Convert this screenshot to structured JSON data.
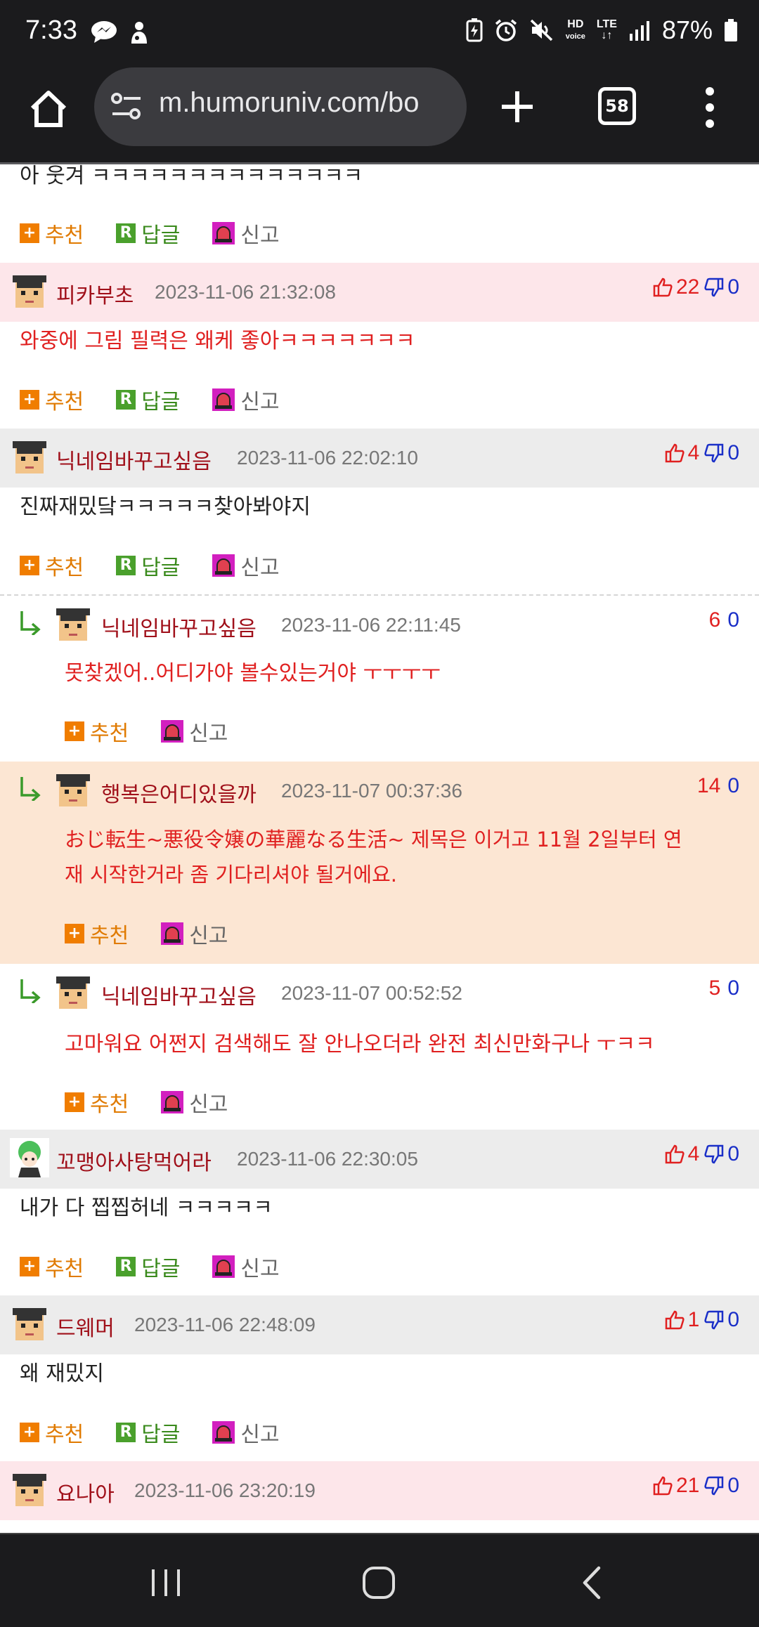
{
  "status": {
    "time": "7:33",
    "battery": "87%",
    "hd_label": "HD",
    "voice_label": "voice",
    "lte_label": "LTE"
  },
  "browser": {
    "url": "m.humoruniv.com/bo",
    "tab_count": "58"
  },
  "actions": {
    "recommend": "추천",
    "reply": "답글",
    "report": "신고"
  },
  "comments": [
    {
      "text": "아 웃겨 ㅋㅋㅋㅋㅋㅋㅋㅋㅋㅋㅋㅋㅋㅋ"
    },
    {
      "nick": "피카부초",
      "date": "2023-11-06 21:32:08",
      "up": "22",
      "down": "0",
      "text": "와중에 그림 필력은 왜케 좋아ㅋㅋㅋㅋㅋㅋㅋ"
    },
    {
      "nick": "닉네임바꾸고싶음",
      "date": "2023-11-06 22:02:10",
      "up": "4",
      "down": "0",
      "text": "진짜재밌닼ㅋㅋㅋㅋㅋ찾아봐야지"
    },
    {
      "nick": "닉네임바꾸고싶음",
      "date": "2023-11-06 22:11:45",
      "up": "6",
      "down": "0",
      "text": "못찾겠어..어디가야 볼수있는거야 ㅜㅜㅜㅜ"
    },
    {
      "nick": "행복은어디있을까",
      "date": "2023-11-07 00:37:36",
      "up": "14",
      "down": "0",
      "text1": "おじ転生~悪役令嬢の華麗なる生活~ 제목은 이거고 11월 2일부터 연",
      "text2": "재 시작한거라 좀 기다리셔야 될거에요."
    },
    {
      "nick": "닉네임바꾸고싶음",
      "date": "2023-11-07 00:52:52",
      "up": "5",
      "down": "0",
      "text": "고마워요 어쩐지 검색해도 잘 안나오더라 완전 최신만화구나 ㅜㅋㅋ"
    },
    {
      "nick": "꼬맹아사탕먹어라",
      "date": "2023-11-06 22:30:05",
      "up": "4",
      "down": "0",
      "text": "내가 다 찝찝허네 ㅋㅋㅋㅋㅋ"
    },
    {
      "nick": "드웨머",
      "date": "2023-11-06 22:48:09",
      "up": "1",
      "down": "0",
      "text": "왜 재밌지"
    },
    {
      "nick": "요나아",
      "date": "2023-11-06 23:20:19",
      "up": "21",
      "down": "0"
    }
  ]
}
